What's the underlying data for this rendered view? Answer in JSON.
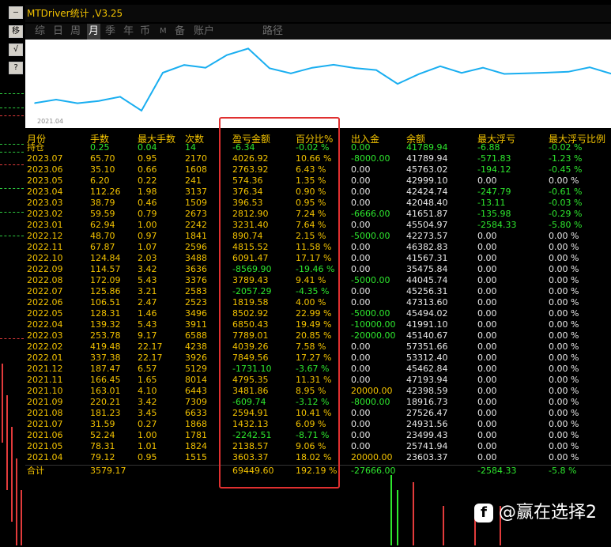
{
  "window": {
    "title": "MTDriver统计 ,V3.25"
  },
  "toolbar": [
    {
      "label": "—"
    },
    {
      "label": "移"
    },
    {
      "label": "√"
    },
    {
      "label": "?"
    }
  ],
  "tabs": [
    {
      "label": "综",
      "active": false
    },
    {
      "label": "日",
      "active": false
    },
    {
      "label": "周",
      "active": false
    },
    {
      "label": "月",
      "active": true
    },
    {
      "label": "季",
      "active": false
    },
    {
      "label": "年",
      "active": false
    },
    {
      "label": "币",
      "active": false
    },
    {
      "label": "M",
      "active": false
    },
    {
      "label": "备",
      "active": false
    },
    {
      "label": "账户",
      "active": false
    },
    {
      "label": "路径",
      "active": false
    }
  ],
  "chart_data": {
    "type": "line",
    "x_label": "2021.04",
    "line_color": "#19aef0",
    "x": [
      "2021.04",
      "2021.05",
      "2021.06",
      "2021.07",
      "2021.08",
      "2021.09",
      "2021.10",
      "2021.11",
      "2021.12",
      "2022.01",
      "2022.02",
      "2022.03",
      "2022.04",
      "2022.05",
      "2022.06",
      "2022.07",
      "2022.08",
      "2022.09",
      "2022.10",
      "2022.11",
      "2022.12",
      "2023.01",
      "2023.02",
      "2023.03",
      "2023.04",
      "2023.05",
      "2023.06",
      "2023.07"
    ],
    "y": [
      23603.37,
      25741.94,
      23499.43,
      24931.56,
      27526.47,
      18916.73,
      42398.59,
      47193.94,
      45462.84,
      53312.4,
      57351.66,
      45140.67,
      41991.1,
      45494.02,
      47313.6,
      45256.31,
      44045.74,
      35475.84,
      41567.31,
      46382.83,
      42273.57,
      45504.97,
      41651.87,
      42048.4,
      42424.74,
      42999.1,
      45763.02,
      41789.94
    ],
    "ylim": [
      15000,
      60000
    ]
  },
  "table": {
    "headers": [
      "月份",
      "手数",
      "最大手数",
      "次数",
      "盈亏金额",
      "百分比%",
      "出入金",
      "余额",
      "最大浮亏",
      "最大浮亏比例"
    ],
    "rows": [
      [
        "持仓",
        "0.25",
        "0.04",
        "14",
        "-6.34",
        "-0.02 %",
        "0.00",
        "41789.94",
        "-6.88",
        "-0.02 %"
      ],
      [
        "2023.07",
        "65.70",
        "0.95",
        "2170",
        "4026.92",
        "10.66 %",
        "-8000.00",
        "41789.94",
        "-571.83",
        "-1.23 %"
      ],
      [
        "2023.06",
        "35.10",
        "0.66",
        "1608",
        "2763.92",
        "6.43 %",
        "0.00",
        "45763.02",
        "-194.12",
        "-0.45 %"
      ],
      [
        "2023.05",
        "6.20",
        "0.22",
        "241",
        "574.36",
        "1.35 %",
        "0.00",
        "42999.10",
        "0.00",
        "0.00 %"
      ],
      [
        "2023.04",
        "112.26",
        "1.98",
        "3137",
        "376.34",
        "0.90 %",
        "0.00",
        "42424.74",
        "-247.79",
        "-0.61 %"
      ],
      [
        "2023.03",
        "38.79",
        "0.46",
        "1509",
        "396.53",
        "0.95 %",
        "0.00",
        "42048.40",
        "-13.11",
        "-0.03 %"
      ],
      [
        "2023.02",
        "59.59",
        "0.79",
        "2673",
        "2812.90",
        "7.24 %",
        "-6666.00",
        "41651.87",
        "-135.98",
        "-0.29 %"
      ],
      [
        "2023.01",
        "62.94",
        "1.00",
        "2242",
        "3231.40",
        "7.64 %",
        "0.00",
        "45504.97",
        "-2584.33",
        "-5.80 %"
      ],
      [
        "2022.12",
        "48.70",
        "0.97",
        "1841",
        "890.74",
        "2.15 %",
        "-5000.00",
        "42273.57",
        "0.00",
        "0.00 %"
      ],
      [
        "2022.11",
        "67.87",
        "1.07",
        "2596",
        "4815.52",
        "11.58 %",
        "0.00",
        "46382.83",
        "0.00",
        "0.00 %"
      ],
      [
        "2022.10",
        "124.84",
        "2.03",
        "3488",
        "6091.47",
        "17.17 %",
        "0.00",
        "41567.31",
        "0.00",
        "0.00 %"
      ],
      [
        "2022.09",
        "114.57",
        "3.42",
        "3636",
        "-8569.90",
        "-19.46 %",
        "0.00",
        "35475.84",
        "0.00",
        "0.00 %"
      ],
      [
        "2022.08",
        "172.09",
        "5.43",
        "3376",
        "3789.43",
        "9.41 %",
        "-5000.00",
        "44045.74",
        "0.00",
        "0.00 %"
      ],
      [
        "2022.07",
        "125.86",
        "3.21",
        "2583",
        "-2057.29",
        "-4.35 %",
        "0.00",
        "45256.31",
        "0.00",
        "0.00 %"
      ],
      [
        "2022.06",
        "106.51",
        "2.47",
        "2523",
        "1819.58",
        "4.00 %",
        "0.00",
        "47313.60",
        "0.00",
        "0.00 %"
      ],
      [
        "2022.05",
        "128.31",
        "1.46",
        "3496",
        "8502.92",
        "22.99 %",
        "-5000.00",
        "45494.02",
        "0.00",
        "0.00 %"
      ],
      [
        "2022.04",
        "139.32",
        "5.43",
        "3911",
        "6850.43",
        "19.49 %",
        "-10000.00",
        "41991.10",
        "0.00",
        "0.00 %"
      ],
      [
        "2022.03",
        "253.78",
        "9.17",
        "6588",
        "7789.01",
        "20.85 %",
        "-20000.00",
        "45140.67",
        "0.00",
        "0.00 %"
      ],
      [
        "2022.02",
        "419.48",
        "22.17",
        "4238",
        "4039.26",
        "7.58 %",
        "0.00",
        "57351.66",
        "0.00",
        "0.00 %"
      ],
      [
        "2022.01",
        "337.38",
        "22.17",
        "3926",
        "7849.56",
        "17.27 %",
        "0.00",
        "53312.40",
        "0.00",
        "0.00 %"
      ],
      [
        "2021.12",
        "187.47",
        "6.57",
        "5129",
        "-1731.10",
        "-3.67 %",
        "0.00",
        "45462.84",
        "0.00",
        "0.00 %"
      ],
      [
        "2021.11",
        "166.45",
        "1.65",
        "8014",
        "4795.35",
        "11.31 %",
        "0.00",
        "47193.94",
        "0.00",
        "0.00 %"
      ],
      [
        "2021.10",
        "163.01",
        "4.10",
        "6443",
        "3481.86",
        "8.95 %",
        "20000.00",
        "42398.59",
        "0.00",
        "0.00 %"
      ],
      [
        "2021.09",
        "220.21",
        "3.42",
        "7309",
        "-609.74",
        "-3.12 %",
        "-8000.00",
        "18916.73",
        "0.00",
        "0.00 %"
      ],
      [
        "2021.08",
        "181.23",
        "3.45",
        "6633",
        "2594.91",
        "10.41 %",
        "0.00",
        "27526.47",
        "0.00",
        "0.00 %"
      ],
      [
        "2021.07",
        "31.59",
        "0.27",
        "1868",
        "1432.13",
        "6.09 %",
        "0.00",
        "24931.56",
        "0.00",
        "0.00 %"
      ],
      [
        "2021.06",
        "52.24",
        "1.00",
        "1781",
        "-2242.51",
        "-8.71 %",
        "0.00",
        "23499.43",
        "0.00",
        "0.00 %"
      ],
      [
        "2021.05",
        "78.31",
        "1.01",
        "1824",
        "2138.57",
        "9.06 %",
        "0.00",
        "25741.94",
        "0.00",
        "0.00 %"
      ],
      [
        "2021.04",
        "79.12",
        "0.95",
        "1515",
        "3603.37",
        "18.02 %",
        "20000.00",
        "23603.37",
        "0.00",
        "0.00 %"
      ]
    ],
    "total": [
      "合计",
      "3579.17",
      "",
      "",
      "69449.60",
      "192.19 %",
      "-27666.00",
      "",
      "-2584.33",
      "-5.8 %"
    ]
  },
  "watermark": {
    "icon": "f",
    "text": "@赢在选择2"
  }
}
